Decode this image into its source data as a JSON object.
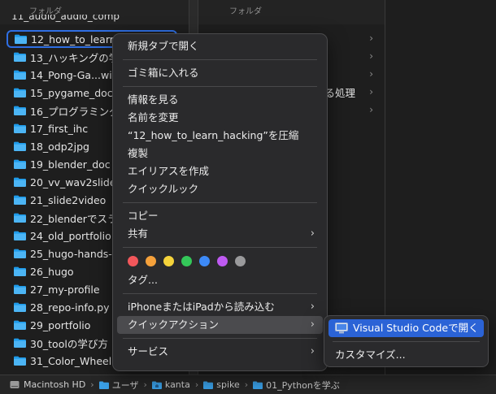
{
  "columns": {
    "col1_header": "フォルダ",
    "col2_header": "フォルダ",
    "col1_partial_top": "11_audio_audio_comp",
    "col2_partial_text": "る処理"
  },
  "folders": [
    "12_how_to_learn",
    "13_ハッキングの学",
    "14_Pong-Ga...wit",
    "15_pygame_doc_",
    "16_プログラミング",
    "17_first_ihc",
    "18_odp2jpg",
    "19_blender_doc",
    "20_vv_wav2slide",
    "21_slide2video",
    "22_blenderでスラ",
    "24_old_portfolio",
    "25_hugo-hands-",
    "26_hugo",
    "27_my-profile",
    "28_repo-info.py",
    "29_portfolio",
    "30_toolの学び方",
    "31_Color_Wheel"
  ],
  "context_menu": {
    "open_new_tab": "新規タブで開く",
    "move_to_trash": "ゴミ箱に入れる",
    "get_info": "情報を見る",
    "rename": "名前を変更",
    "compress": "“12_how_to_learn_hacking”を圧縮",
    "duplicate": "複製",
    "make_alias": "エイリアスを作成",
    "quick_look": "クイックルック",
    "copy": "コピー",
    "share": "共有",
    "tags": "タグ...",
    "import_from_iphone": "iPhoneまたはiPadから読み込む",
    "quick_actions": "クイックアクション",
    "services": "サービス"
  },
  "tag_colors": [
    "#f2575b",
    "#f5a13b",
    "#f5d33b",
    "#34c759",
    "#3d8af7",
    "#bf5af2",
    "#9a9a9c"
  ],
  "submenu": {
    "open_vscode": "Visual Studio Codeで開く",
    "customize": "カスタマイズ..."
  },
  "pathbar": {
    "disk": "Macintosh HD",
    "users": "ユーザ",
    "user": "kanta",
    "spike": "spike",
    "folder": "01_Pythonを学ぶ"
  }
}
